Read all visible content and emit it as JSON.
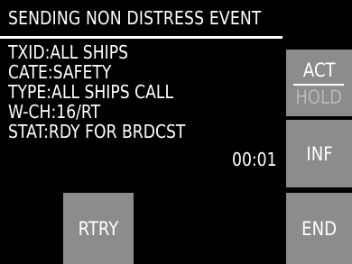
{
  "header": {
    "title": "SENDING NON DISTRESS EVENT"
  },
  "info": {
    "lines": [
      "TXID:ALL SHIPS",
      "CATE:SAFETY",
      "TYPE:ALL SHIPS CALL",
      "W-CH:16/RT",
      "STAT:RDY FOR BRDCST"
    ],
    "timer": "00:01"
  },
  "buttons": {
    "act_hold": {
      "top": "ACT",
      "bottom": "HOLD",
      "active": "ACT"
    },
    "inf": "INF",
    "end": "END",
    "rtry": "RTRY"
  },
  "colors": {
    "background": "#000000",
    "text": "#ffffff",
    "button": "#8c8c8c",
    "inactive_text": "#b8b8b8"
  }
}
